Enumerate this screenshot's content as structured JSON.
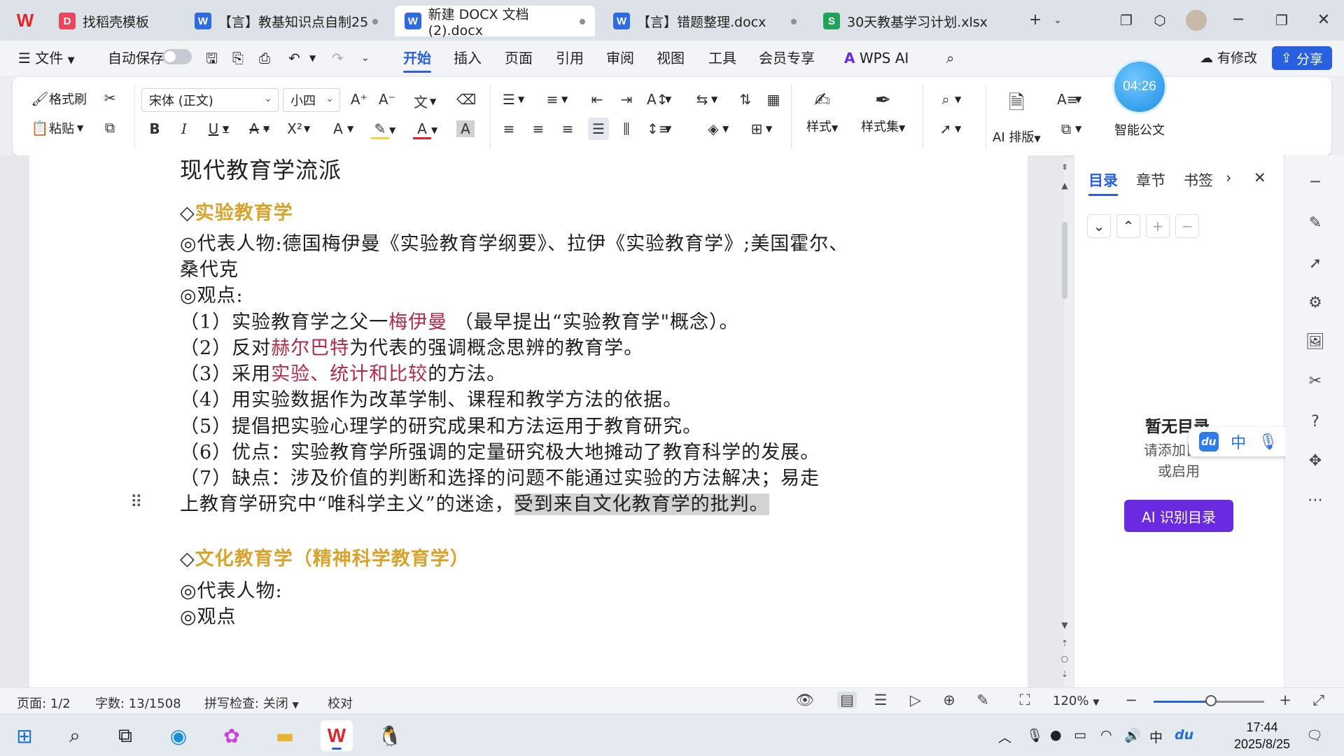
{
  "tabs": [
    {
      "label": "找稻壳模板",
      "icon": "docer-icon",
      "icon_text": "D",
      "color": "#e8465b"
    },
    {
      "label": "【言】教基知识点自制25",
      "icon": "word-doc-icon",
      "icon_text": "W",
      "color": "#2f6be0"
    },
    {
      "label": "新建 DOCX 文档 (2).docx",
      "icon": "word-doc-icon",
      "icon_text": "W",
      "color": "#2f6be0"
    },
    {
      "label": "【言】错题整理.docx",
      "icon": "word-doc-icon",
      "icon_text": "W",
      "color": "#2f6be0"
    },
    {
      "label": "30天教基学习计划.xlsx",
      "icon": "sheet-icon",
      "icon_text": "S",
      "color": "#22a35a"
    }
  ],
  "menu": {
    "file": "文件",
    "autosave": "自动保存",
    "items": [
      "开始",
      "插入",
      "页面",
      "引用",
      "审阅",
      "视图",
      "工具",
      "会员专享",
      "WPS AI"
    ],
    "modified": "有修改",
    "share": "分享"
  },
  "ribbon": {
    "format_painter": "格式刷",
    "paste": "粘贴",
    "font_name": "宋体 (正文)",
    "font_size": "小四",
    "styles": "样式",
    "style_set": "样式集",
    "ai_layout": "AI 排版",
    "smart_doc": "智能公文",
    "timer": "04:26"
  },
  "document": {
    "title": "现代教育学流派",
    "section1": "实验教育学",
    "rep1a": "◎代表人物:德国梅伊曼《实验教育学纲要》、拉伊《实验教育学》;美国霍尔、",
    "rep1b": "桑代克",
    "view1": "◎观点:",
    "p1_pre": "（1）实验教育学之父一",
    "p1_red": "梅伊曼",
    "p1_post": " （最早提出“实验教育学\"概念）。",
    "p2_pre": "（2）反对",
    "p2_red": "赫尔巴特",
    "p2_post": "为代表的强调概念思辨的教育学。",
    "p3_pre": "（3）采用",
    "p3_red": "实验、统计和比较",
    "p3_post": "的方法。",
    "p4": "（4）用实验数据作为改革学制、课程和教学方法的依据。",
    "p5": "（5）提倡把实验心理学的研究成果和方法运用于教育研究。",
    "p6": "（6）优点：实验教育学所强调的定量研究极大地摊动了教育科学的发展。",
    "p7a": "（7）缺点：涉及价值的判断和选择的问题不能通过实验的方法解决；易走",
    "p7b_pre": "上教育学研究中“唯科学主义”的迷途，",
    "p7b_hl": "受到来自文化教育学的批判。",
    "section2": "文化教育学（精神科学教育学）",
    "rep2": "◎代表人物:",
    "view2": "◎观点"
  },
  "nav_pane": {
    "tabs": [
      "目录",
      "章节",
      "书签"
    ],
    "empty_title": "暂无目录",
    "empty_desc": "请添加目录或启用",
    "ai_button": "AI 识别目录"
  },
  "ime": {
    "mode": "中"
  },
  "status": {
    "page": "页面: 1/2",
    "words": "字数: 13/1508",
    "spell": "拼写检查: 关闭",
    "proof": "校对",
    "zoom": "120%",
    "zoom_level_percent": 50
  },
  "taskbar": {
    "time": "17:44",
    "date": "2025/8/25",
    "input_lang": "中"
  },
  "colors": {
    "accent": "#2860e1",
    "heading_gold": "#d9a42d",
    "emphasis_red": "#b02a4a",
    "ai_purple": "#6a2be0"
  }
}
